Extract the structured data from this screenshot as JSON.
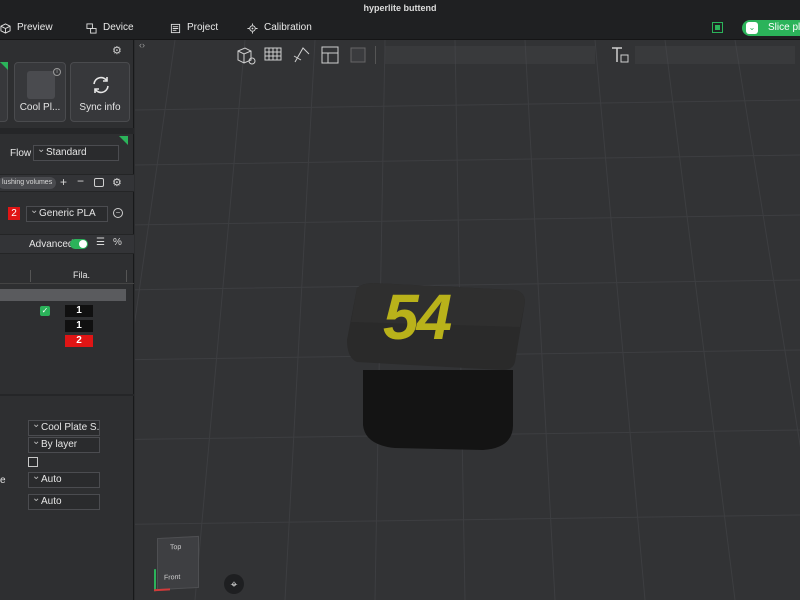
{
  "window": {
    "title": "hyperlite buttend"
  },
  "menu": {
    "items": [
      {
        "label": "Preview",
        "icon": "cube-icon"
      },
      {
        "label": "Device",
        "icon": "device-icon"
      },
      {
        "label": "Project",
        "icon": "project-icon"
      },
      {
        "label": "Calibration",
        "icon": "calibration-icon"
      }
    ],
    "slice_label": "Slice pla"
  },
  "printer": {
    "plate_label": "Cool Pl...",
    "sync_label": "Sync info"
  },
  "process": {
    "flow_label": "Flow",
    "flow_value": "Standard"
  },
  "filament": {
    "flushing_label": "lushing volumes",
    "slot_number": "2",
    "slot_color": "#e01515",
    "material": "Generic PLA",
    "advanced_label": "Advanced"
  },
  "table": {
    "fila_header": "Fila.",
    "rows": [
      {
        "value": "1",
        "bg": "#101010"
      },
      {
        "value": "1",
        "bg": "#101010"
      },
      {
        "value": "2",
        "bg": "#e01515"
      }
    ]
  },
  "settings": {
    "plate_type": "Cool Plate S...",
    "sequence": "By layer",
    "row3_prefix": "e",
    "auto_a": "Auto",
    "auto_b": "Auto"
  },
  "viewport": {
    "model_text": "54",
    "model_text_color": "#b9b21a",
    "cube_top": "Top",
    "cube_front": "Front"
  },
  "colors": {
    "accent": "#2bb35a",
    "panel": "#2e2f31",
    "viewport_bg": "#323335"
  }
}
